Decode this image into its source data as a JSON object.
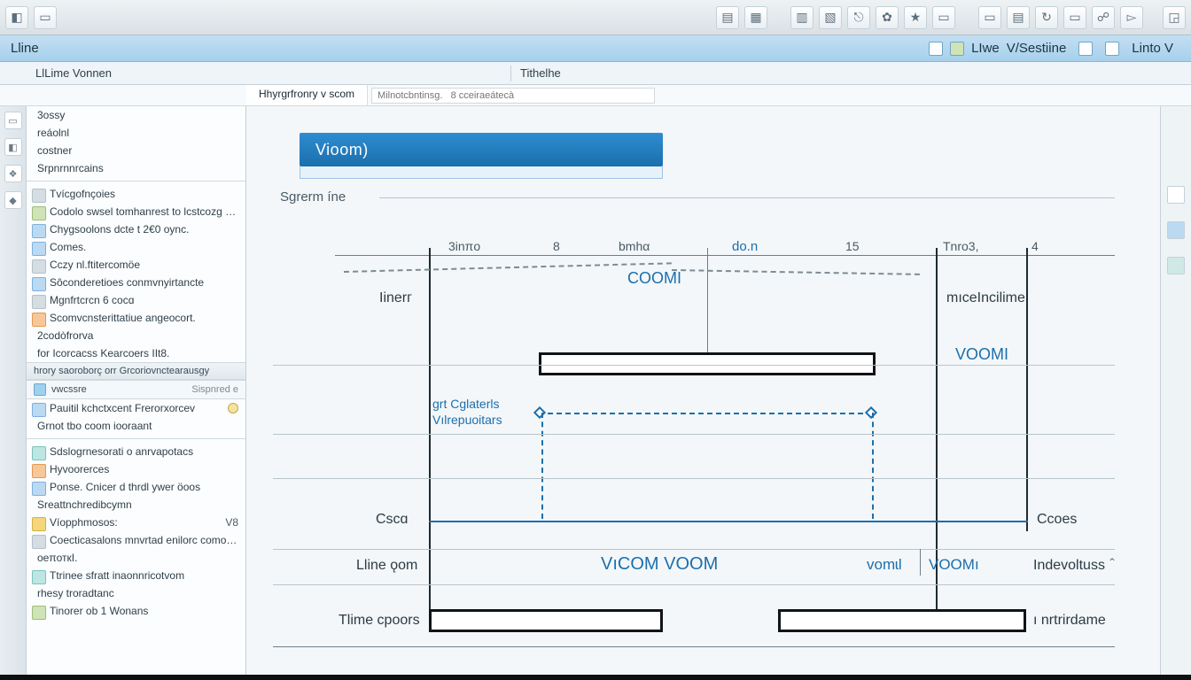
{
  "toolbar_icons": [
    "doc",
    "open",
    "grid",
    "grid2",
    "layout",
    "layout2",
    "link",
    "gear",
    "star",
    "page",
    "save",
    "db",
    "refresh",
    "page2",
    "users",
    "export",
    "corner"
  ],
  "titlebar": {
    "title": "Lline",
    "tab2": "LIwe",
    "right1": "V/Sestiine",
    "right2": "Linto V"
  },
  "docbar": {
    "left": "LlLime Vonnen",
    "center": "Tithelhe"
  },
  "subtabs": {
    "active": "Hhyrgrfronry v scom",
    "placeholder": "Milnotcbntinsg.   8 cceiraeátecà"
  },
  "sidebar": {
    "group1": [
      "3ossy",
      "reáolnl",
      "costner",
      "Srpnrnnrcains"
    ],
    "group2": [
      "Tvícgofnçoies",
      "Codolo swsel tomhanrest to lcstcozɡ Enstbs",
      "Chygsoolons dcte t 2€0 oync.",
      "Comes.",
      "Cczy nl.ftitercomöe",
      "Sôconderetioes conmvnyirtancte",
      "Mgnfrtcrcn 6 cocɑ",
      "Scomvcnsterittatiue angeocort.",
      "2codòfrorva",
      "for Icorcacss Kearcoers IIt8."
    ],
    "hdr2": {
      "label": "hrory saoroborç orr Grcoriovnctearausgy"
    },
    "group3_hdr": {
      "left": "vwcssre",
      "right": "Sispnred e"
    },
    "group3": [
      "Pauitil kchctxcent Frerorxorcev",
      "Grnot tbo coom iooraant"
    ],
    "group4": [
      "Sdslogrnesorati o anrvapotacs",
      "Hyvoorerces",
      "Ponse. Cnicer d thrdl ywer öoos",
      "Sreattnchredibcymn",
      "Víopphmosos:",
      "Coecticasalons mnvrtad enilorc comomonouscs.",
      "оеπоткI.",
      "Ttrinee sfratt inaonnricotvom",
      "rhesy troradtanc",
      "Tinorer ob 1 Wonans"
    ],
    "group4_right": "V8"
  },
  "diagram": {
    "button": "Vioom)",
    "subtitle": "Sgrerm íne",
    "ticks": [
      "3inπo",
      "8",
      "bmhα",
      "do.n",
      "15",
      "Tnro3,",
      "4"
    ],
    "center_label": "COOMI",
    "right_col_top": "mıceIncilime",
    "right_col_mid": "VOOMI",
    "row_inter": "Iinerг",
    "row_mid_a": "grt Cglaterls",
    "row_mid_b": "Vılrepuoitars",
    "row_csce": "Cscɑ",
    "row_csce_r": "Ccoes",
    "row_line": "Lline ǫom",
    "row_line_center": "VıCOM VOOM",
    "row_line_pair1": "vomɩl",
    "row_line_pair2": "VOOMı",
    "row_line_r": "Indevoltuss",
    "row_time": "Tlime cpoors",
    "row_time_r": "ı nrtrirdame"
  }
}
